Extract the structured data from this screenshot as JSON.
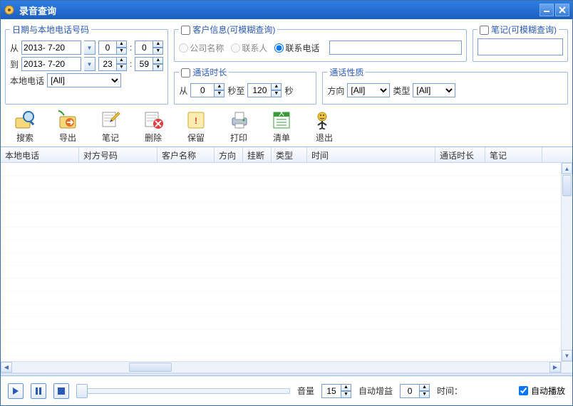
{
  "window": {
    "title": "录音查询"
  },
  "filters": {
    "date_group": "日期与本地电话号码",
    "from_lbl": "从",
    "to_lbl": "到",
    "date_from": "2013- 7-20",
    "date_to": "2013- 7-20",
    "h_from": "0",
    "m_from": "0",
    "h_to": "23",
    "m_to": "59",
    "colon": ":",
    "local_phone_lbl": "本地电话",
    "local_phone_val": "[All]",
    "cust_group": "客户信息(可模糊查询)",
    "r_company": "公司名称",
    "r_contact": "联系人",
    "r_tel": "联系电话",
    "notes_group": "笔记(可模糊查询)",
    "dur_group": "通话时长",
    "dur_from_lbl": "从",
    "dur_from": "0",
    "dur_sec_to": "秒至",
    "dur_to": "120",
    "dur_sec": "秒",
    "nat_group": "通话性质",
    "dir_lbl": "方向",
    "dir_val": "[All]",
    "type_lbl": "类型",
    "type_val": "[All]"
  },
  "toolbar": [
    "搜索",
    "导出",
    "笔记",
    "删除",
    "保留",
    "打印",
    "清单",
    "退出"
  ],
  "columns": [
    {
      "label": "本地电话",
      "w": 110
    },
    {
      "label": "对方号码",
      "w": 110
    },
    {
      "label": "客户名称",
      "w": 80
    },
    {
      "label": "方向",
      "w": 40
    },
    {
      "label": "挂断",
      "w": 40
    },
    {
      "label": "类型",
      "w": 50
    },
    {
      "label": "时间",
      "w": 180
    },
    {
      "label": "通话时长",
      "w": 70
    },
    {
      "label": "笔记",
      "w": 80
    }
  ],
  "player": {
    "vol_lbl": "音量",
    "vol_val": "15",
    "gain_lbl": "自动增益",
    "gain_val": "0",
    "time_lbl": "时间：",
    "autoplay_lbl": "自动播放"
  }
}
